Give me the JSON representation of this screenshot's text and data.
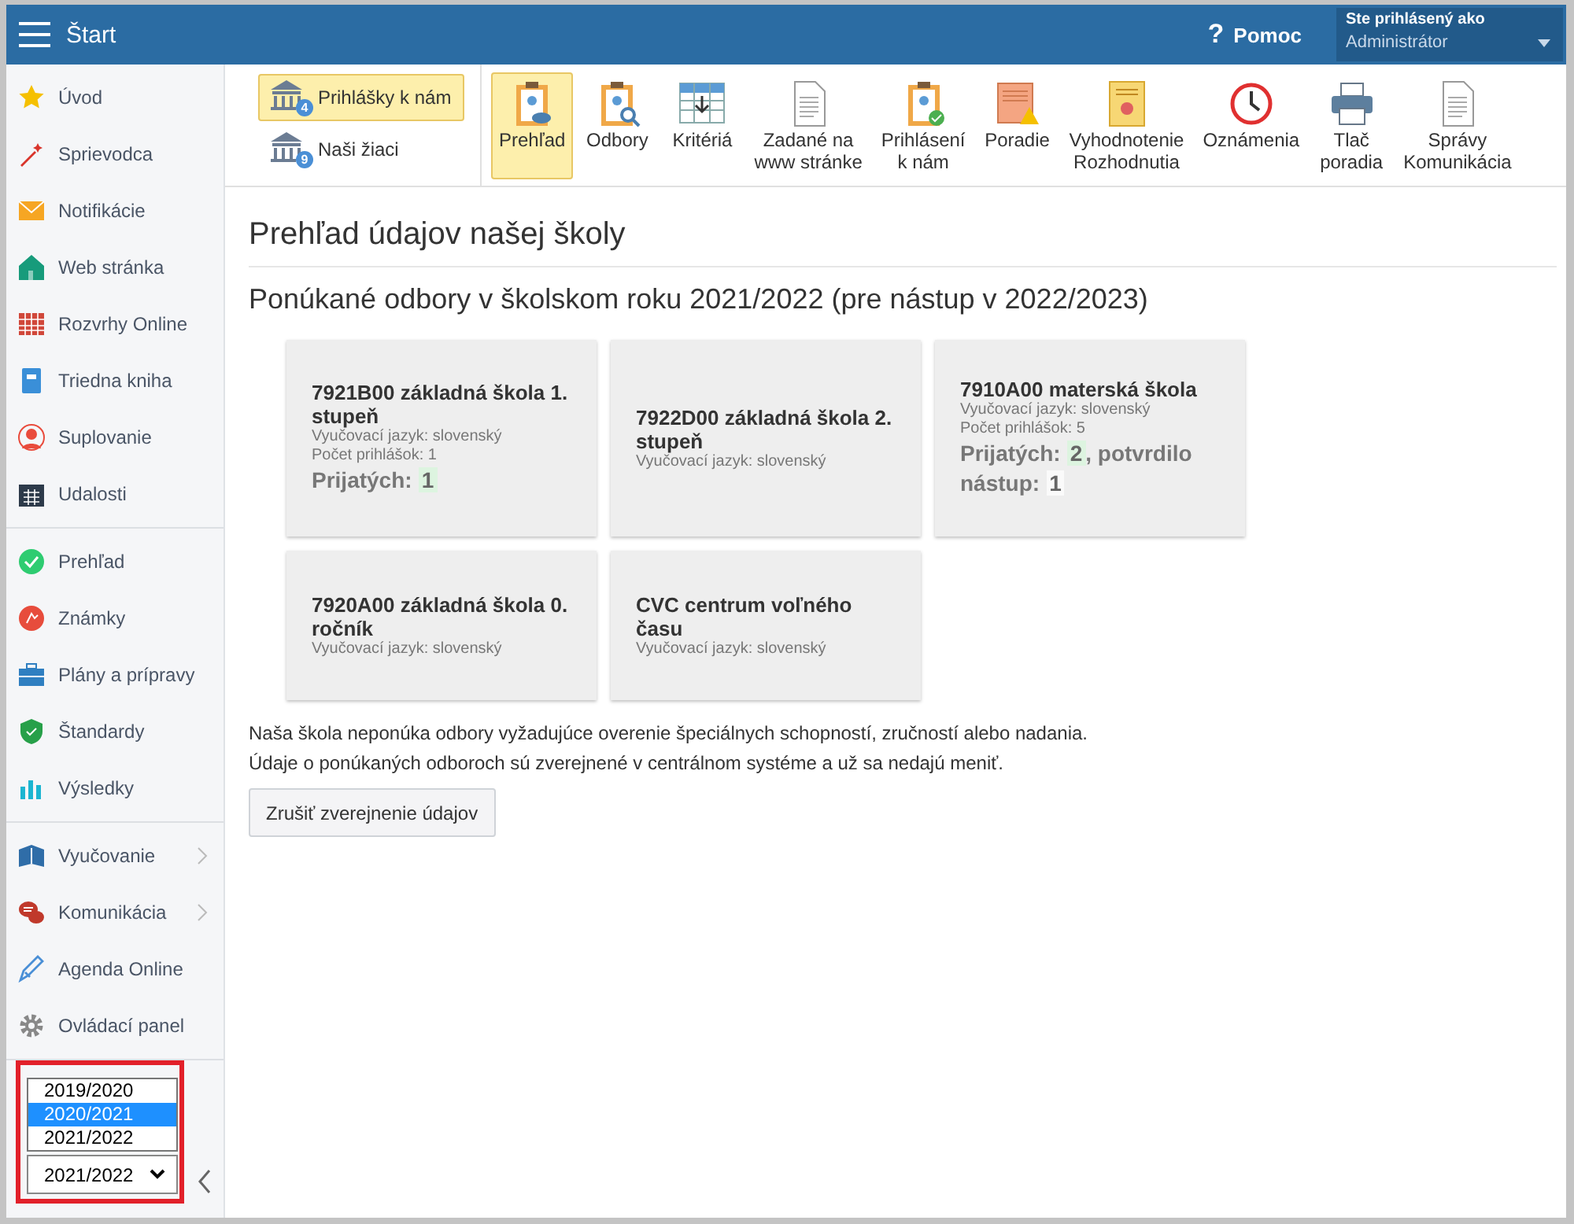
{
  "topbar": {
    "title": "Štart",
    "help_icon": "?",
    "help": "Pomoc",
    "user_label": "Ste prihlásený ako",
    "user_name": "Administrátor"
  },
  "sidebar": {
    "groups": [
      [
        {
          "label": "Úvod",
          "arrow": false
        },
        {
          "label": "Sprievodca",
          "arrow": false
        },
        {
          "label": "Notifikácie",
          "arrow": false
        },
        {
          "label": "Web stránka",
          "arrow": false
        },
        {
          "label": "Rozvrhy Online",
          "arrow": false
        },
        {
          "label": "Triedna kniha",
          "arrow": false
        },
        {
          "label": "Suplovanie",
          "arrow": false
        },
        {
          "label": "Udalosti",
          "arrow": false
        }
      ],
      [
        {
          "label": "Prehľad",
          "arrow": false
        },
        {
          "label": "Známky",
          "arrow": false
        },
        {
          "label": "Plány a prípravy",
          "arrow": false
        },
        {
          "label": "Štandardy",
          "arrow": false
        },
        {
          "label": "Výsledky",
          "arrow": false
        }
      ],
      [
        {
          "label": "Vyučovanie",
          "arrow": true
        },
        {
          "label": "Komunikácia",
          "arrow": true
        },
        {
          "label": "Agenda Online",
          "arrow": false
        },
        {
          "label": "Ovládací panel",
          "arrow": false
        }
      ]
    ],
    "year_options": [
      {
        "label": "2019/2020",
        "selected": false
      },
      {
        "label": "2020/2021",
        "selected": true
      },
      {
        "label": "2021/2022",
        "selected": false
      }
    ],
    "year_value": "2021/2022"
  },
  "toolbar": {
    "modules": [
      {
        "label": "Prihlášky k nám",
        "badge": "4",
        "selected": true
      },
      {
        "label": "Naši žiaci",
        "badge": "9",
        "selected": false
      }
    ],
    "actions": [
      {
        "label": "Prehľad",
        "selected": true
      },
      {
        "label": "Odbory",
        "selected": false
      },
      {
        "label": "Kritériá",
        "selected": false
      },
      {
        "label": "Zadané na\nwww stránke",
        "selected": false
      },
      {
        "label": "Prihlásení\nk nám",
        "selected": false
      },
      {
        "label": "Poradie",
        "selected": false
      },
      {
        "label": "Vyhodnotenie\nRozhodnutia",
        "selected": false
      },
      {
        "label": "Oznámenia",
        "selected": false
      },
      {
        "label": "Tlač\nporadia",
        "selected": false
      },
      {
        "label": "Správy\nKomunikácia",
        "selected": false
      }
    ]
  },
  "content": {
    "title": "Prehľad údajov našej školy",
    "subtitle": "Ponúkané odbory v školskom roku 2021/2022 (pre nástup v 2022/2023)",
    "cards": [
      {
        "title": "7921B00 základná škola 1. stupeň",
        "lines": [
          "Vyučovací jazyk: slovenský",
          "Počet prihlášok: 1"
        ],
        "summary": [
          {
            "kind": "text",
            "text": "Prijatých:"
          },
          {
            "kind": "accepted",
            "text": "1"
          }
        ]
      },
      {
        "title": "7922D00 základná škola 2. stupeň",
        "lines": [
          "Vyučovací jazyk: slovenský"
        ]
      },
      {
        "title": "7910A00 materská škola",
        "lines": [
          "Vyučovací jazyk: slovenský",
          "Počet prihlášok: 5"
        ],
        "summary": [
          {
            "kind": "text",
            "text": "Prijatých:"
          },
          {
            "kind": "accepted",
            "text": "2"
          },
          {
            "kind": "text",
            "text": ", potvrdilo nástup:"
          },
          {
            "kind": "confirmed",
            "text": "1"
          }
        ]
      },
      {
        "title": "7920A00 základná škola 0. ročník",
        "lines": [
          "Vyučovací jazyk: slovenský"
        ]
      },
      {
        "title": "CVC centrum voľného času",
        "lines": [
          "Vyučovací jazyk: slovenský"
        ]
      }
    ],
    "notes": [
      "Naša škola neponúka odbory vyžadujúce overenie špeciálnych schopností, zručností alebo nadania.",
      "Údaje o ponúkaných odboroch sú zverejnené v centrálnom systéme a už sa nedajú meniť."
    ],
    "button": "Zrušiť zverejnenie údajov"
  }
}
